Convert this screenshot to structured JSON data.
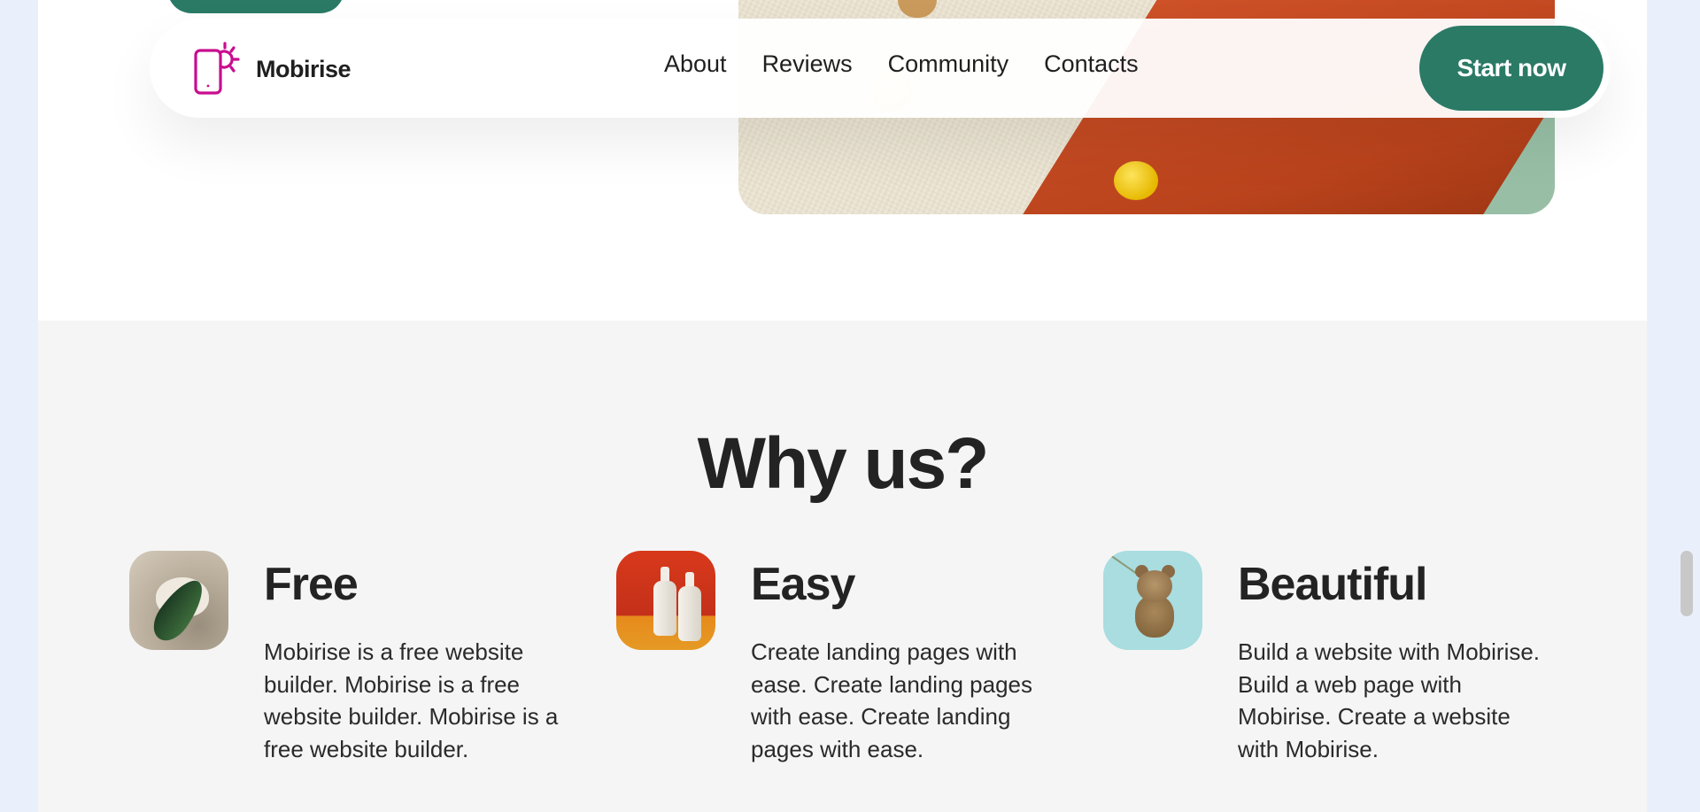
{
  "brand": {
    "name": "Mobirise",
    "icon": "phone-sun-icon",
    "icon_color": "#c80d8f"
  },
  "nav": {
    "links": [
      {
        "label": "About"
      },
      {
        "label": "Reviews"
      },
      {
        "label": "Community"
      },
      {
        "label": "Contacts"
      }
    ],
    "cta_label": "Start now"
  },
  "colors": {
    "accent": "#2a7a66",
    "section_bg": "#f5f5f5",
    "text": "#232323"
  },
  "why": {
    "title": "Why us?",
    "features": [
      {
        "title": "Free",
        "text": "Mobirise is a free website builder. Mobirise is a free website builder. Mobirise is a free website builder.",
        "thumb": "leaf-on-stone-image"
      },
      {
        "title": "Easy",
        "text": "Create landing pages with ease. Create landing pages with ease. Create landing pages with ease.",
        "thumb": "cosmetic-bottles-image"
      },
      {
        "title": "Beautiful",
        "text": "Build a website with Mobirise. Build a web page with Mobirise. Create a website with Mobirise.",
        "thumb": "teddy-bear-image"
      }
    ]
  }
}
